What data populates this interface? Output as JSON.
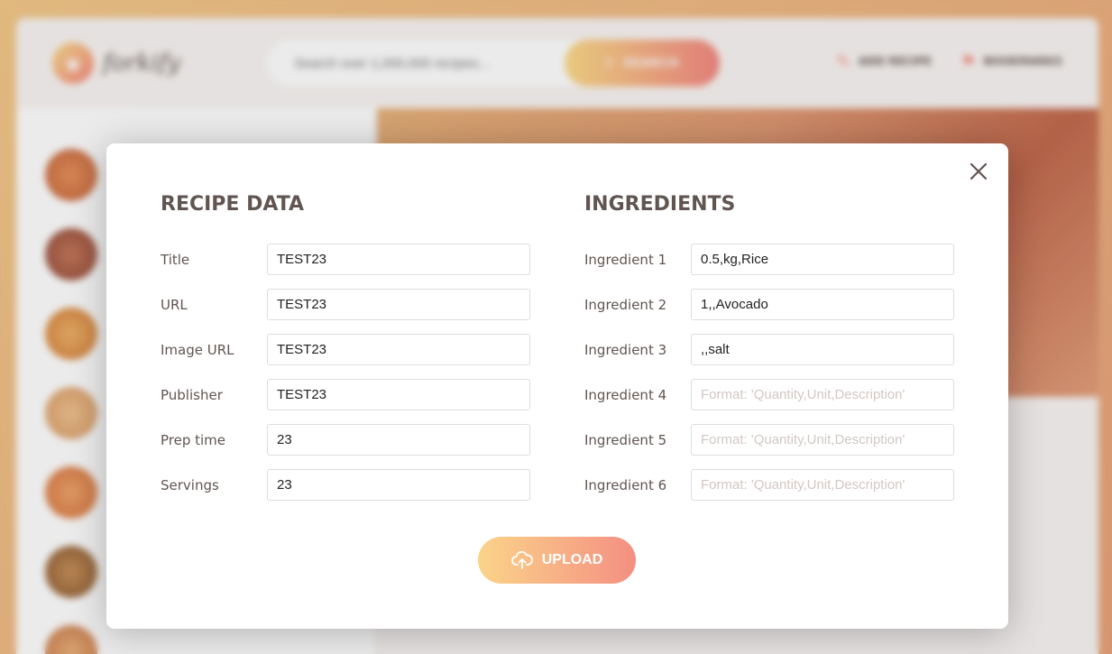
{
  "background_app": {
    "logo_text": "forkify",
    "search_placeholder": "Search over 1,000,000 recipes...",
    "search_button": "SEARCH",
    "nav": [
      {
        "label": "ADD RECIPE",
        "icon": "edit-icon"
      },
      {
        "label": "BOOKMARKS",
        "icon": "bookmark-icon"
      }
    ]
  },
  "modal": {
    "recipe_heading": "RECIPE DATA",
    "ingredients_heading": "INGREDIENTS",
    "recipe_fields": [
      {
        "label": "Title",
        "value": "TEST23"
      },
      {
        "label": "URL",
        "value": "TEST23"
      },
      {
        "label": "Image URL",
        "value": "TEST23"
      },
      {
        "label": "Publisher",
        "value": "TEST23"
      },
      {
        "label": "Prep time",
        "value": "23"
      },
      {
        "label": "Servings",
        "value": "23"
      }
    ],
    "ingredient_fields": [
      {
        "label": "Ingredient 1",
        "value": "0.5,kg,Rice",
        "placeholder": "Format: 'Quantity,Unit,Description'"
      },
      {
        "label": "Ingredient 2",
        "value": "1,,Avocado",
        "placeholder": "Format: 'Quantity,Unit,Description'"
      },
      {
        "label": "Ingredient 3",
        "value": ",,salt",
        "placeholder": "Format: 'Quantity,Unit,Description'"
      },
      {
        "label": "Ingredient 4",
        "value": "",
        "placeholder": "Format: 'Quantity,Unit,Description'"
      },
      {
        "label": "Ingredient 5",
        "value": "",
        "placeholder": "Format: 'Quantity,Unit,Description'"
      },
      {
        "label": "Ingredient 6",
        "value": "",
        "placeholder": "Format: 'Quantity,Unit,Description'"
      }
    ],
    "upload_label": "UPLOAD",
    "close_icon": "close-icon",
    "upload_icon": "upload-cloud-icon"
  },
  "colors": {
    "accent_start": "#fbdb89",
    "accent_end": "#f48982",
    "text": "#615551"
  }
}
